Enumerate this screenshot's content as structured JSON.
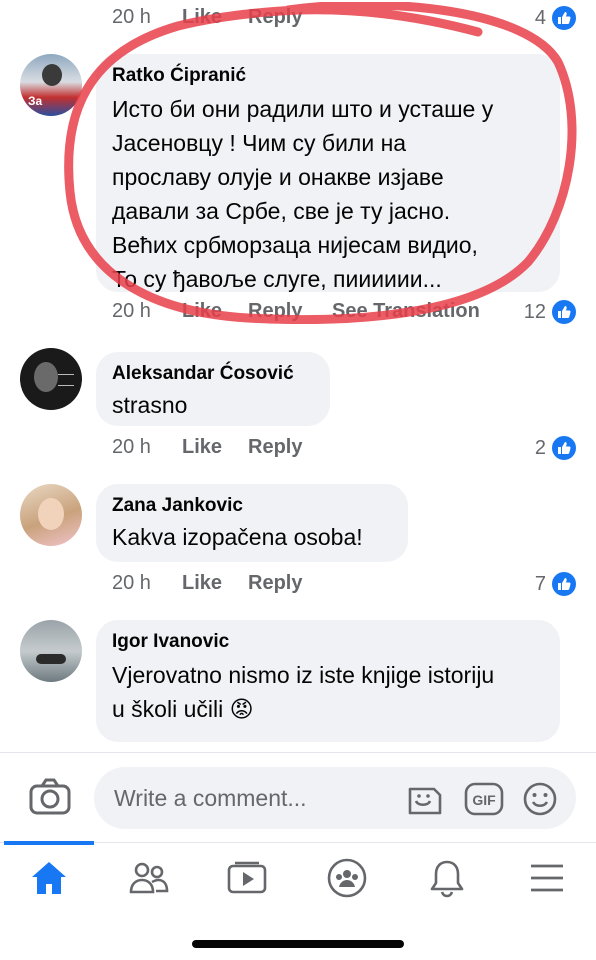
{
  "top_meta": {
    "time": "20 h",
    "like": "Like",
    "reply": "Reply",
    "likes": "4"
  },
  "comments": [
    {
      "author": "Ratko Ćipranić",
      "lines": [
        "Исто би они радили што и усташе у",
        "Јасеновцу ! Чим су били на",
        "прославу олује и онакве изјаве",
        "давали за Србе, све је ту јасно.",
        "Већих србморзаца нијесам видио,",
        "То су ђавоље слуге,  пииииии..."
      ],
      "time": "20 h",
      "like": "Like",
      "reply": "Reply",
      "translate": "See Translation",
      "likes": "12",
      "avatar_badge": "За"
    },
    {
      "author": "Aleksandar Ćosović",
      "lines": [
        "strasno"
      ],
      "time": "20 h",
      "like": "Like",
      "reply": "Reply",
      "likes": "2"
    },
    {
      "author": "Zana Jankovic",
      "lines": [
        "Kakva izopačena osoba!"
      ],
      "time": "20 h",
      "like": "Like",
      "reply": "Reply",
      "likes": "7"
    },
    {
      "author": "Igor Ivanovic",
      "lines": [
        "Vjerovatno nismo iz iste knjige istoriju",
        "u školi učili 😡"
      ]
    }
  ],
  "composer": {
    "placeholder": "Write a comment...",
    "icons": [
      "camera-icon",
      "sticker-icon",
      "gif-icon",
      "emoji-icon"
    ]
  },
  "gif_label": "GIF",
  "tabs": [
    "home-icon",
    "friends-icon",
    "watch-icon",
    "groups-icon",
    "notifications-icon",
    "menu-icon"
  ],
  "colors": {
    "accent": "#1877f2",
    "bubble": "#f0f2f5",
    "meta": "#65676b",
    "highlight": "#e8404a"
  }
}
